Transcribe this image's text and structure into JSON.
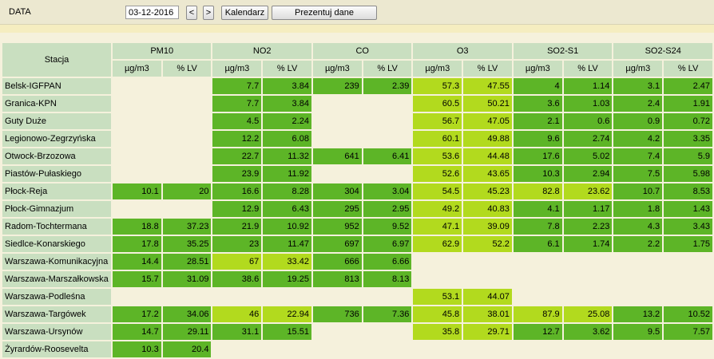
{
  "toolbar": {
    "data_label": "DATA",
    "date_value": "03-12-2016",
    "prev_label": "<",
    "next_label": ">",
    "calendar_label": "Kalendarz",
    "present_label": "Prezentuj dane"
  },
  "colors": {
    "e": "#f5f1dc",
    "g": "#5db527",
    "l": "#b2da1e",
    "header": "#c9dfc0"
  },
  "table": {
    "station_header": "Stacja",
    "groups": [
      "PM10",
      "NO2",
      "CO",
      "O3",
      "SO2-S1",
      "SO2-S24"
    ],
    "units": [
      "µg/m3",
      "% LV"
    ],
    "rows": [
      {
        "station": "Belsk-IGFPAN",
        "cells": [
          {
            "v": "",
            "c": "e"
          },
          {
            "v": "",
            "c": "e"
          },
          {
            "v": "7.7",
            "c": "g"
          },
          {
            "v": "3.84",
            "c": "g"
          },
          {
            "v": "239",
            "c": "g"
          },
          {
            "v": "2.39",
            "c": "g"
          },
          {
            "v": "57.3",
            "c": "l"
          },
          {
            "v": "47.55",
            "c": "l"
          },
          {
            "v": "4",
            "c": "g"
          },
          {
            "v": "1.14",
            "c": "g"
          },
          {
            "v": "3.1",
            "c": "g"
          },
          {
            "v": "2.47",
            "c": "g"
          }
        ]
      },
      {
        "station": "Granica-KPN",
        "cells": [
          {
            "v": "",
            "c": "e"
          },
          {
            "v": "",
            "c": "e"
          },
          {
            "v": "7.7",
            "c": "g"
          },
          {
            "v": "3.84",
            "c": "g"
          },
          {
            "v": "",
            "c": "e"
          },
          {
            "v": "",
            "c": "e"
          },
          {
            "v": "60.5",
            "c": "l"
          },
          {
            "v": "50.21",
            "c": "l"
          },
          {
            "v": "3.6",
            "c": "g"
          },
          {
            "v": "1.03",
            "c": "g"
          },
          {
            "v": "2.4",
            "c": "g"
          },
          {
            "v": "1.91",
            "c": "g"
          }
        ]
      },
      {
        "station": "Guty Duże",
        "cells": [
          {
            "v": "",
            "c": "e"
          },
          {
            "v": "",
            "c": "e"
          },
          {
            "v": "4.5",
            "c": "g"
          },
          {
            "v": "2.24",
            "c": "g"
          },
          {
            "v": "",
            "c": "e"
          },
          {
            "v": "",
            "c": "e"
          },
          {
            "v": "56.7",
            "c": "l"
          },
          {
            "v": "47.05",
            "c": "l"
          },
          {
            "v": "2.1",
            "c": "g"
          },
          {
            "v": "0.6",
            "c": "g"
          },
          {
            "v": "0.9",
            "c": "g"
          },
          {
            "v": "0.72",
            "c": "g"
          }
        ]
      },
      {
        "station": "Legionowo-Zegrzyńska",
        "cells": [
          {
            "v": "",
            "c": "e"
          },
          {
            "v": "",
            "c": "e"
          },
          {
            "v": "12.2",
            "c": "g"
          },
          {
            "v": "6.08",
            "c": "g"
          },
          {
            "v": "",
            "c": "e"
          },
          {
            "v": "",
            "c": "e"
          },
          {
            "v": "60.1",
            "c": "l"
          },
          {
            "v": "49.88",
            "c": "l"
          },
          {
            "v": "9.6",
            "c": "g"
          },
          {
            "v": "2.74",
            "c": "g"
          },
          {
            "v": "4.2",
            "c": "g"
          },
          {
            "v": "3.35",
            "c": "g"
          }
        ]
      },
      {
        "station": "Otwock-Brzozowa",
        "cells": [
          {
            "v": "",
            "c": "e"
          },
          {
            "v": "",
            "c": "e"
          },
          {
            "v": "22.7",
            "c": "g"
          },
          {
            "v": "11.32",
            "c": "g"
          },
          {
            "v": "641",
            "c": "g"
          },
          {
            "v": "6.41",
            "c": "g"
          },
          {
            "v": "53.6",
            "c": "l"
          },
          {
            "v": "44.48",
            "c": "l"
          },
          {
            "v": "17.6",
            "c": "g"
          },
          {
            "v": "5.02",
            "c": "g"
          },
          {
            "v": "7.4",
            "c": "g"
          },
          {
            "v": "5.9",
            "c": "g"
          }
        ]
      },
      {
        "station": "Piastów-Pułaskiego",
        "cells": [
          {
            "v": "",
            "c": "e"
          },
          {
            "v": "",
            "c": "e"
          },
          {
            "v": "23.9",
            "c": "g"
          },
          {
            "v": "11.92",
            "c": "g"
          },
          {
            "v": "",
            "c": "e"
          },
          {
            "v": "",
            "c": "e"
          },
          {
            "v": "52.6",
            "c": "l"
          },
          {
            "v": "43.65",
            "c": "l"
          },
          {
            "v": "10.3",
            "c": "g"
          },
          {
            "v": "2.94",
            "c": "g"
          },
          {
            "v": "7.5",
            "c": "g"
          },
          {
            "v": "5.98",
            "c": "g"
          }
        ]
      },
      {
        "station": "Płock-Reja",
        "cells": [
          {
            "v": "10.1",
            "c": "g"
          },
          {
            "v": "20",
            "c": "g"
          },
          {
            "v": "16.6",
            "c": "g"
          },
          {
            "v": "8.28",
            "c": "g"
          },
          {
            "v": "304",
            "c": "g"
          },
          {
            "v": "3.04",
            "c": "g"
          },
          {
            "v": "54.5",
            "c": "l"
          },
          {
            "v": "45.23",
            "c": "l"
          },
          {
            "v": "82.8",
            "c": "l"
          },
          {
            "v": "23.62",
            "c": "l"
          },
          {
            "v": "10.7",
            "c": "g"
          },
          {
            "v": "8.53",
            "c": "g"
          }
        ]
      },
      {
        "station": "Płock-Gimnazjum",
        "cells": [
          {
            "v": "",
            "c": "e"
          },
          {
            "v": "",
            "c": "e"
          },
          {
            "v": "12.9",
            "c": "g"
          },
          {
            "v": "6.43",
            "c": "g"
          },
          {
            "v": "295",
            "c": "g"
          },
          {
            "v": "2.95",
            "c": "g"
          },
          {
            "v": "49.2",
            "c": "l"
          },
          {
            "v": "40.83",
            "c": "l"
          },
          {
            "v": "4.1",
            "c": "g"
          },
          {
            "v": "1.17",
            "c": "g"
          },
          {
            "v": "1.8",
            "c": "g"
          },
          {
            "v": "1.43",
            "c": "g"
          }
        ]
      },
      {
        "station": "Radom-Tochtermana",
        "cells": [
          {
            "v": "18.8",
            "c": "g"
          },
          {
            "v": "37.23",
            "c": "g"
          },
          {
            "v": "21.9",
            "c": "g"
          },
          {
            "v": "10.92",
            "c": "g"
          },
          {
            "v": "952",
            "c": "g"
          },
          {
            "v": "9.52",
            "c": "g"
          },
          {
            "v": "47.1",
            "c": "l"
          },
          {
            "v": "39.09",
            "c": "l"
          },
          {
            "v": "7.8",
            "c": "g"
          },
          {
            "v": "2.23",
            "c": "g"
          },
          {
            "v": "4.3",
            "c": "g"
          },
          {
            "v": "3.43",
            "c": "g"
          }
        ]
      },
      {
        "station": "Siedlce-Konarskiego",
        "cells": [
          {
            "v": "17.8",
            "c": "g"
          },
          {
            "v": "35.25",
            "c": "g"
          },
          {
            "v": "23",
            "c": "g"
          },
          {
            "v": "11.47",
            "c": "g"
          },
          {
            "v": "697",
            "c": "g"
          },
          {
            "v": "6.97",
            "c": "g"
          },
          {
            "v": "62.9",
            "c": "l"
          },
          {
            "v": "52.2",
            "c": "l"
          },
          {
            "v": "6.1",
            "c": "g"
          },
          {
            "v": "1.74",
            "c": "g"
          },
          {
            "v": "2.2",
            "c": "g"
          },
          {
            "v": "1.75",
            "c": "g"
          }
        ]
      },
      {
        "station": "Warszawa-Komunikacyjna",
        "cells": [
          {
            "v": "14.4",
            "c": "g"
          },
          {
            "v": "28.51",
            "c": "g"
          },
          {
            "v": "67",
            "c": "l"
          },
          {
            "v": "33.42",
            "c": "l"
          },
          {
            "v": "666",
            "c": "g"
          },
          {
            "v": "6.66",
            "c": "g"
          },
          {
            "v": "",
            "c": "e"
          },
          {
            "v": "",
            "c": "e"
          },
          {
            "v": "",
            "c": "e"
          },
          {
            "v": "",
            "c": "e"
          },
          {
            "v": "",
            "c": "e"
          },
          {
            "v": "",
            "c": "e"
          }
        ]
      },
      {
        "station": "Warszawa-Marszałkowska",
        "cells": [
          {
            "v": "15.7",
            "c": "g"
          },
          {
            "v": "31.09",
            "c": "g"
          },
          {
            "v": "38.6",
            "c": "g"
          },
          {
            "v": "19.25",
            "c": "g"
          },
          {
            "v": "813",
            "c": "g"
          },
          {
            "v": "8.13",
            "c": "g"
          },
          {
            "v": "",
            "c": "e"
          },
          {
            "v": "",
            "c": "e"
          },
          {
            "v": "",
            "c": "e"
          },
          {
            "v": "",
            "c": "e"
          },
          {
            "v": "",
            "c": "e"
          },
          {
            "v": "",
            "c": "e"
          }
        ]
      },
      {
        "station": "Warszawa-Podleśna",
        "cells": [
          {
            "v": "",
            "c": "e"
          },
          {
            "v": "",
            "c": "e"
          },
          {
            "v": "",
            "c": "e"
          },
          {
            "v": "",
            "c": "e"
          },
          {
            "v": "",
            "c": "e"
          },
          {
            "v": "",
            "c": "e"
          },
          {
            "v": "53.1",
            "c": "l"
          },
          {
            "v": "44.07",
            "c": "l"
          },
          {
            "v": "",
            "c": "e"
          },
          {
            "v": "",
            "c": "e"
          },
          {
            "v": "",
            "c": "e"
          },
          {
            "v": "",
            "c": "e"
          }
        ]
      },
      {
        "station": "Warszawa-Targówek",
        "cells": [
          {
            "v": "17.2",
            "c": "g"
          },
          {
            "v": "34.06",
            "c": "g"
          },
          {
            "v": "46",
            "c": "l"
          },
          {
            "v": "22.94",
            "c": "l"
          },
          {
            "v": "736",
            "c": "g"
          },
          {
            "v": "7.36",
            "c": "g"
          },
          {
            "v": "45.8",
            "c": "l"
          },
          {
            "v": "38.01",
            "c": "l"
          },
          {
            "v": "87.9",
            "c": "l"
          },
          {
            "v": "25.08",
            "c": "l"
          },
          {
            "v": "13.2",
            "c": "g"
          },
          {
            "v": "10.52",
            "c": "g"
          }
        ]
      },
      {
        "station": "Warszawa-Ursynów",
        "cells": [
          {
            "v": "14.7",
            "c": "g"
          },
          {
            "v": "29.11",
            "c": "g"
          },
          {
            "v": "31.1",
            "c": "g"
          },
          {
            "v": "15.51",
            "c": "g"
          },
          {
            "v": "",
            "c": "e"
          },
          {
            "v": "",
            "c": "e"
          },
          {
            "v": "35.8",
            "c": "l"
          },
          {
            "v": "29.71",
            "c": "l"
          },
          {
            "v": "12.7",
            "c": "g"
          },
          {
            "v": "3.62",
            "c": "g"
          },
          {
            "v": "9.5",
            "c": "g"
          },
          {
            "v": "7.57",
            "c": "g"
          }
        ]
      },
      {
        "station": "Żyrardów-Roosevelta",
        "cells": [
          {
            "v": "10.3",
            "c": "g"
          },
          {
            "v": "20.4",
            "c": "g"
          },
          {
            "v": "",
            "c": "e"
          },
          {
            "v": "",
            "c": "e"
          },
          {
            "v": "",
            "c": "e"
          },
          {
            "v": "",
            "c": "e"
          },
          {
            "v": "",
            "c": "e"
          },
          {
            "v": "",
            "c": "e"
          },
          {
            "v": "",
            "c": "e"
          },
          {
            "v": "",
            "c": "e"
          },
          {
            "v": "",
            "c": "e"
          },
          {
            "v": "",
            "c": "e"
          }
        ]
      }
    ]
  }
}
